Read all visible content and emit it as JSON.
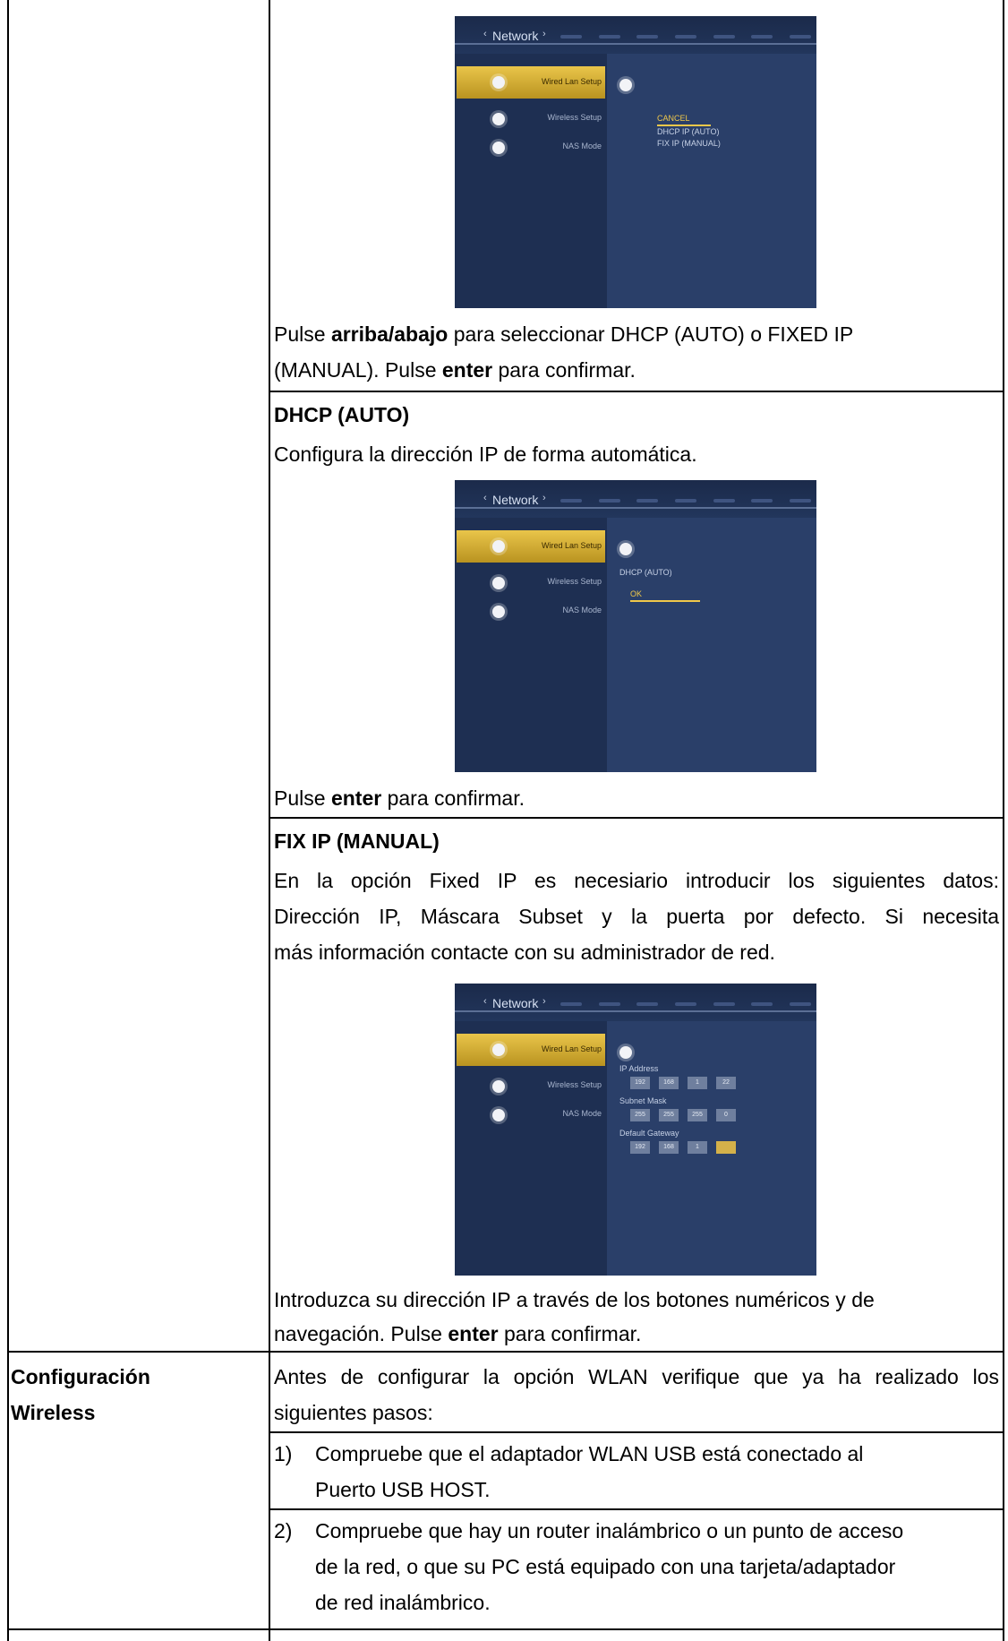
{
  "screens": {
    "network_label": "Network",
    "menu_items": [
      "Wired Lan Setup",
      "Wireless Setup",
      "NAS Mode"
    ],
    "screen1_options": [
      "CANCEL",
      "DHCP IP (AUTO)",
      "FIX IP (MANUAL)"
    ],
    "screen2_title": "DHCP (AUTO)",
    "screen2_ok": "OK",
    "screen3": {
      "ip_label": "IP Address",
      "ip_values": [
        "192",
        "168",
        "1",
        "22"
      ],
      "subnet_label": "Subnet Mask",
      "subnet_values": [
        "255",
        "255",
        "255",
        "0"
      ],
      "gateway_label": "Default Gateway",
      "gateway_values": [
        "192",
        "168",
        "1",
        ""
      ]
    }
  },
  "text": {
    "p1_a": "Pulse ",
    "p1_b": "arriba/abajo",
    "p1_c": " para seleccionar DHCP (AUTO) o FIXED IP",
    "p1_d": "(MANUAL). Pulse ",
    "p1_e": "enter",
    "p1_f": " para confirmar.",
    "dhcp_heading": "DHCP (AUTO)",
    "dhcp_desc": "Configura la dirección IP de forma automática.",
    "p2_a": "Pulse ",
    "p2_b": "enter",
    "p2_c": " para confirmar.",
    "fix_heading": "FIX IP (MANUAL)",
    "fix_line1": "En la opción Fixed IP es necesiario introducir los siguientes datos:",
    "fix_line2": "Dirección IP, Máscara Subset y la puerta por defecto. Si necesita",
    "fix_line3": "más información contacte con su administrador de red.",
    "p3_line1": "Introduzca su dirección IP a través de los botones numéricos y de",
    "p3_a": "navegación. Pulse ",
    "p3_b": "enter",
    "p3_c": " para confirmar.",
    "wireless_label_1": "Configuración",
    "wireless_label_2": "Wireless",
    "w_line1": "Antes de configurar la opción WLAN verifique que ya ha realizado los",
    "w_line2": "siguientes pasos:",
    "step1_num": "1)",
    "step1_line1": "Compruebe que el adaptador WLAN USB está conectado al",
    "step1_line2": "Puerto USB HOST.",
    "step2_num": "2)",
    "step2_line1": "Compruebe que hay un router inalámbrico o un punto de acceso",
    "step2_line2": "de la red, o que su PC está equipado con una tarjeta/adaptador",
    "step2_line3": "de red inalámbrico."
  }
}
